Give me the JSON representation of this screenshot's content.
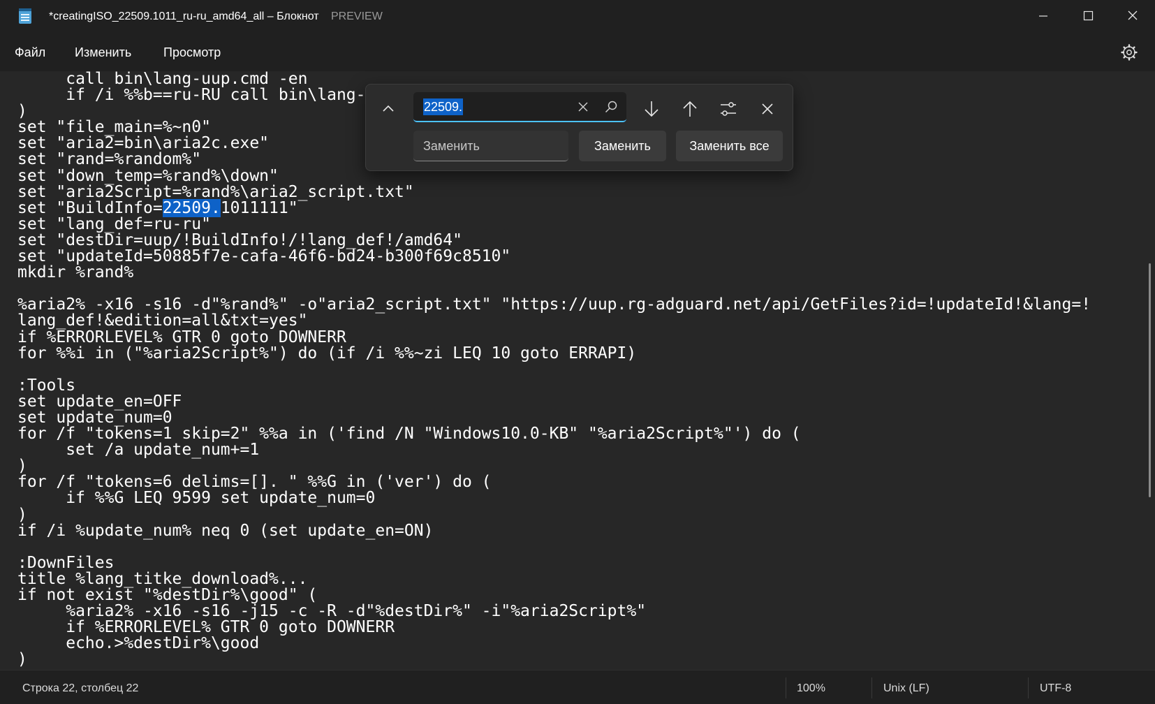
{
  "window": {
    "title": "*creatingISO_22509.1011_ru-ru_amd64_all – Блокнот",
    "preview_tag": "PREVIEW"
  },
  "menu": {
    "file": "Файл",
    "edit": "Изменить",
    "view": "Просмотр"
  },
  "editor": {
    "highlighted_match": "22509.",
    "lines": [
      "     call bin\\lang-uup.cmd -en",
      "     if /i %%b==ru-RU call bin\\lang-",
      ")",
      "set \"file_main=%~n0\"",
      "set \"aria2=bin\\aria2c.exe\"",
      "set \"rand=%random%\"",
      "set \"down_temp=%rand%\\down\"",
      "set \"aria2Script=%rand%\\aria2_script.txt\"",
      "set \"BuildInfo=22509.1011111\"",
      "set \"lang_def=ru-ru\"",
      "set \"destDir=uup/!BuildInfo!/!lang_def!/amd64\"",
      "set \"updateId=50885f7e-cafa-46f6-bd24-b300f69c8510\"",
      "mkdir %rand%",
      "",
      "%aria2% -x16 -s16 -d\"%rand%\" -o\"aria2_script.txt\" \"https://uup.rg-adguard.net/api/GetFiles?id=!updateId!&lang=!",
      "lang_def!&edition=all&txt=yes\"",
      "if %ERRORLEVEL% GTR 0 goto DOWNERR",
      "for %%i in (\"%aria2Script%\") do (if /i %%~zi LEQ 10 goto ERRAPI)",
      "",
      ":Tools",
      "set update_en=OFF",
      "set update_num=0",
      "for /f \"tokens=1 skip=2\" %%a in ('find /N \"Windows10.0-KB\" \"%aria2Script%\"') do (",
      "     set /a update_num+=1",
      ")",
      "for /f \"tokens=6 delims=[]. \" %%G in ('ver') do (",
      "     if %%G LEQ 9599 set update_num=0",
      ")",
      "if /i %update_num% neq 0 (set update_en=ON)",
      "",
      ":DownFiles",
      "title %lang_titke_download%...",
      "if not exist \"%destDir%\\good\" (",
      "     %aria2% -x16 -s16 -j15 -c -R -d\"%destDir%\" -i\"%aria2Script%\"",
      "     if %ERRORLEVEL% GTR 0 goto DOWNERR",
      "     echo.>%destDir%\\good",
      ")"
    ]
  },
  "find_replace": {
    "search_value": "22509.",
    "replace_placeholder": "Заменить",
    "replace_button": "Заменить",
    "replace_all_button": "Заменить все"
  },
  "status": {
    "position": "Строка 22, столбец 22",
    "zoom": "100%",
    "line_ending": "Unix (LF)",
    "encoding": "UTF-8"
  },
  "colors": {
    "background": "#272727",
    "chrome": "#202020",
    "selection": "#0e62c8",
    "accent": "#4cc2ff"
  }
}
